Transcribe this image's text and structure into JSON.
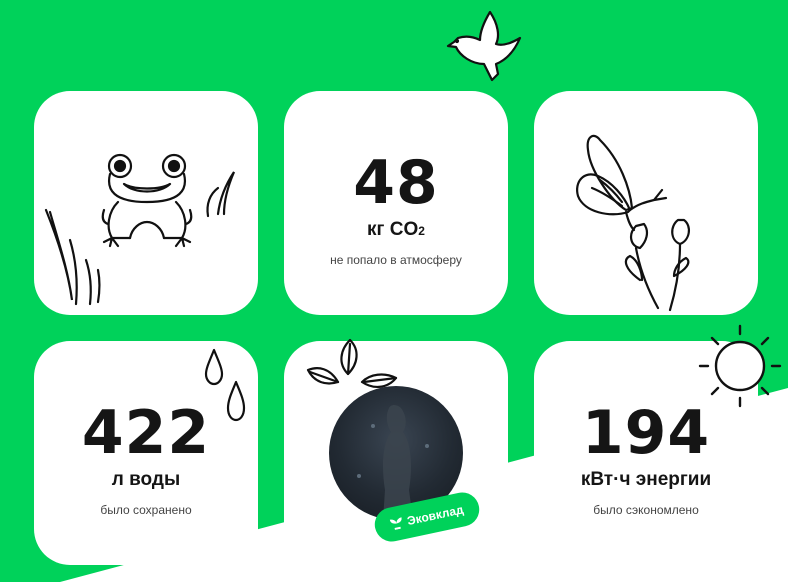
{
  "colors": {
    "accent": "#00d25a",
    "card": "#ffffff",
    "text": "#151515"
  },
  "stats": {
    "co2": {
      "value": "48",
      "unit_prefix": "кг CO",
      "unit_sub": "2",
      "caption": "не попало в атмосферу"
    },
    "water": {
      "value": "422",
      "unit": "л воды",
      "caption": "было сохранено"
    },
    "energy": {
      "value": "194",
      "unit": "кВт·ч энергии",
      "caption": "было сэкономлено"
    }
  },
  "profile": {
    "badge_label": "Эковклад",
    "badge_icon": "sprout-icon"
  },
  "illustrations": [
    "frog-icon",
    "butterfly-icon",
    "bird-icon",
    "drops-icon",
    "leaves-icon",
    "sun-icon"
  ]
}
